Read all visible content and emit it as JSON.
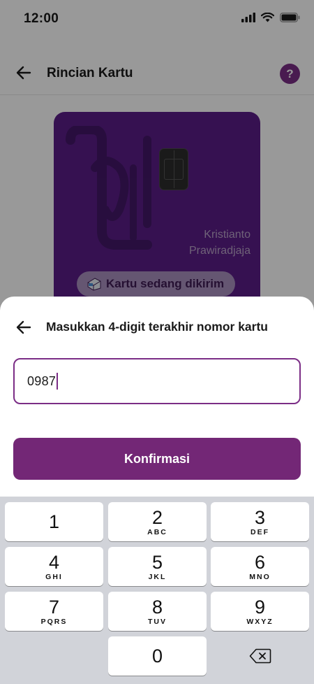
{
  "status_bar": {
    "time": "12:00"
  },
  "header": {
    "title": "Rincian Kartu",
    "help_label": "?"
  },
  "card": {
    "holder_line1": "Kristianto",
    "holder_line2": "Prawiradjaja",
    "status_pill": "Kartu sedang dikirim"
  },
  "sheet": {
    "title": "Masukkan 4-digit terakhir nomor kartu",
    "input_value": "0987",
    "confirm_label": "Konfirmasi"
  },
  "keypad": {
    "keys": [
      {
        "num": "1",
        "letters": ""
      },
      {
        "num": "2",
        "letters": "ABC"
      },
      {
        "num": "3",
        "letters": "DEF"
      },
      {
        "num": "4",
        "letters": "GHI"
      },
      {
        "num": "5",
        "letters": "JKL"
      },
      {
        "num": "6",
        "letters": "MNO"
      },
      {
        "num": "7",
        "letters": "PQRS"
      },
      {
        "num": "8",
        "letters": "TUV"
      },
      {
        "num": "9",
        "letters": "WXYZ"
      },
      {
        "num": "0",
        "letters": ""
      }
    ]
  },
  "colors": {
    "accent": "#732776",
    "card": "#5a1d87",
    "keypad_bg": "#d1d3d9"
  },
  "icons": [
    "back-arrow-icon",
    "help-icon",
    "signal-icon",
    "wifi-icon",
    "battery-icon",
    "card-logo-icon",
    "chip-icon",
    "truck-icon",
    "delete-icon"
  ]
}
